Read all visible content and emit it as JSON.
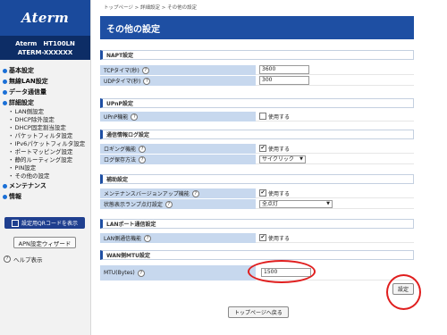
{
  "sidebar": {
    "logo": "Aterm",
    "model": "Aterm　HT100LN",
    "device_id": "ATERM-XXXXXX",
    "main_items": [
      "基本設定",
      "無線LAN設定",
      "データ通信量",
      "詳細設定"
    ],
    "sub_items": [
      "LAN側設定",
      "DHCP除外設定",
      "DHCP固定割当設定",
      "パケットフィルタ設定",
      "IPv6パケットフィルタ設定",
      "ポートマッピング設定",
      "静的ルーティング設定",
      "PIN設定",
      "その他の設定"
    ],
    "bottom_items": [
      "メンテナンス",
      "情報"
    ],
    "qr_button": "設定用QRコードを表示",
    "apn_button": "APN設定ウィザード",
    "help_link": "ヘルプ表示"
  },
  "breadcrumb": "トップページ > 詳細設定 > その他の設定",
  "page_title": "その他の設定",
  "napt": {
    "header": "NAPT設定",
    "tcp_label": "TCPタイマ(秒)",
    "tcp_value": "3600",
    "udp_label": "UDPタイマ(秒)",
    "udp_value": "300"
  },
  "upnp": {
    "header": "UPnP設定",
    "label": "UPnP機能",
    "check_label": "使用する",
    "checked": false
  },
  "log": {
    "header": "通信情報ログ設定",
    "logging_label": "ロギング機能",
    "logging_check_label": "使用する",
    "logging_checked": true,
    "method_label": "ログ保存方法",
    "method_value": "サイクリック"
  },
  "assist": {
    "header": "補助設定",
    "maint_label": "メンテナンスバージョンアップ機能",
    "maint_check_label": "使用する",
    "maint_checked": true,
    "lamp_label": "状態表示ランプ点灯設定",
    "lamp_value": "全点灯"
  },
  "lanport": {
    "header": "LANポート通信設定",
    "label": "LAN側通信機能",
    "check_label": "使用する",
    "checked": true
  },
  "wanmtu": {
    "header": "WAN側MTU設定",
    "label": "MTU(Bytes)",
    "value": "1500"
  },
  "help_glyph": "?",
  "check_glyph": "✔",
  "dropdown_glyph": "▼",
  "buttons": {
    "set": "設定",
    "top": "トップページへ戻る"
  },
  "colors": {
    "title_bar": "#1e4fa3",
    "label_bg": "#c7d8ee",
    "highlight": "#e01e1e",
    "qr_button": "#1f3f8f"
  }
}
